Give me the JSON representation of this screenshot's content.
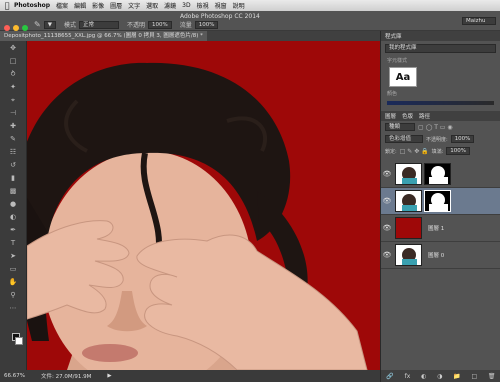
{
  "menubar": {
    "apple": "",
    "app": "Photoshop",
    "items": [
      "檔案",
      "編輯",
      "影像",
      "圖層",
      "文字",
      "選取",
      "濾鏡",
      "3D",
      "檢視",
      "視窗",
      "說明"
    ]
  },
  "window_title": "Adobe Photoshop CC 2014",
  "options": {
    "mode_label": "模式",
    "mode_value": "正常",
    "opacity_label": "不透明",
    "opacity_value": "100%",
    "flow_label": "流量",
    "flow_value": "100%",
    "workspace": "Maizhu"
  },
  "document_tab": "Depositphoto_11138655_XXL.jpg @ 66.7% (圖層 0 拷貝 3, 圖層遮色片/8) *",
  "status": {
    "zoom": "66.67%",
    "doc_size": "文件: 27.0M/91.9M"
  },
  "panels": {
    "libraries_tab": "程式庫",
    "library_select": "我的程式庫",
    "char_styles": "字元樣式",
    "aa_sample": "Aa",
    "colors": "顏色",
    "layer_tabs": [
      "圖層",
      "色版",
      "路徑"
    ],
    "kind": "種類",
    "blend": "色彩增值",
    "opacity_label": "不透明度:",
    "opacity_value": "100%",
    "lock_label": "鎖定:",
    "fill_label": "填滿:",
    "fill_value": "100%",
    "layers": [
      {
        "name": "",
        "selected": false
      },
      {
        "name": "",
        "selected": true
      },
      {
        "name": "圖層 1",
        "selected": false
      },
      {
        "name": "圖層 0",
        "selected": false
      }
    ]
  },
  "colors": {
    "canvas_bg": "#9e0808",
    "selection": "#6b7a8f"
  }
}
